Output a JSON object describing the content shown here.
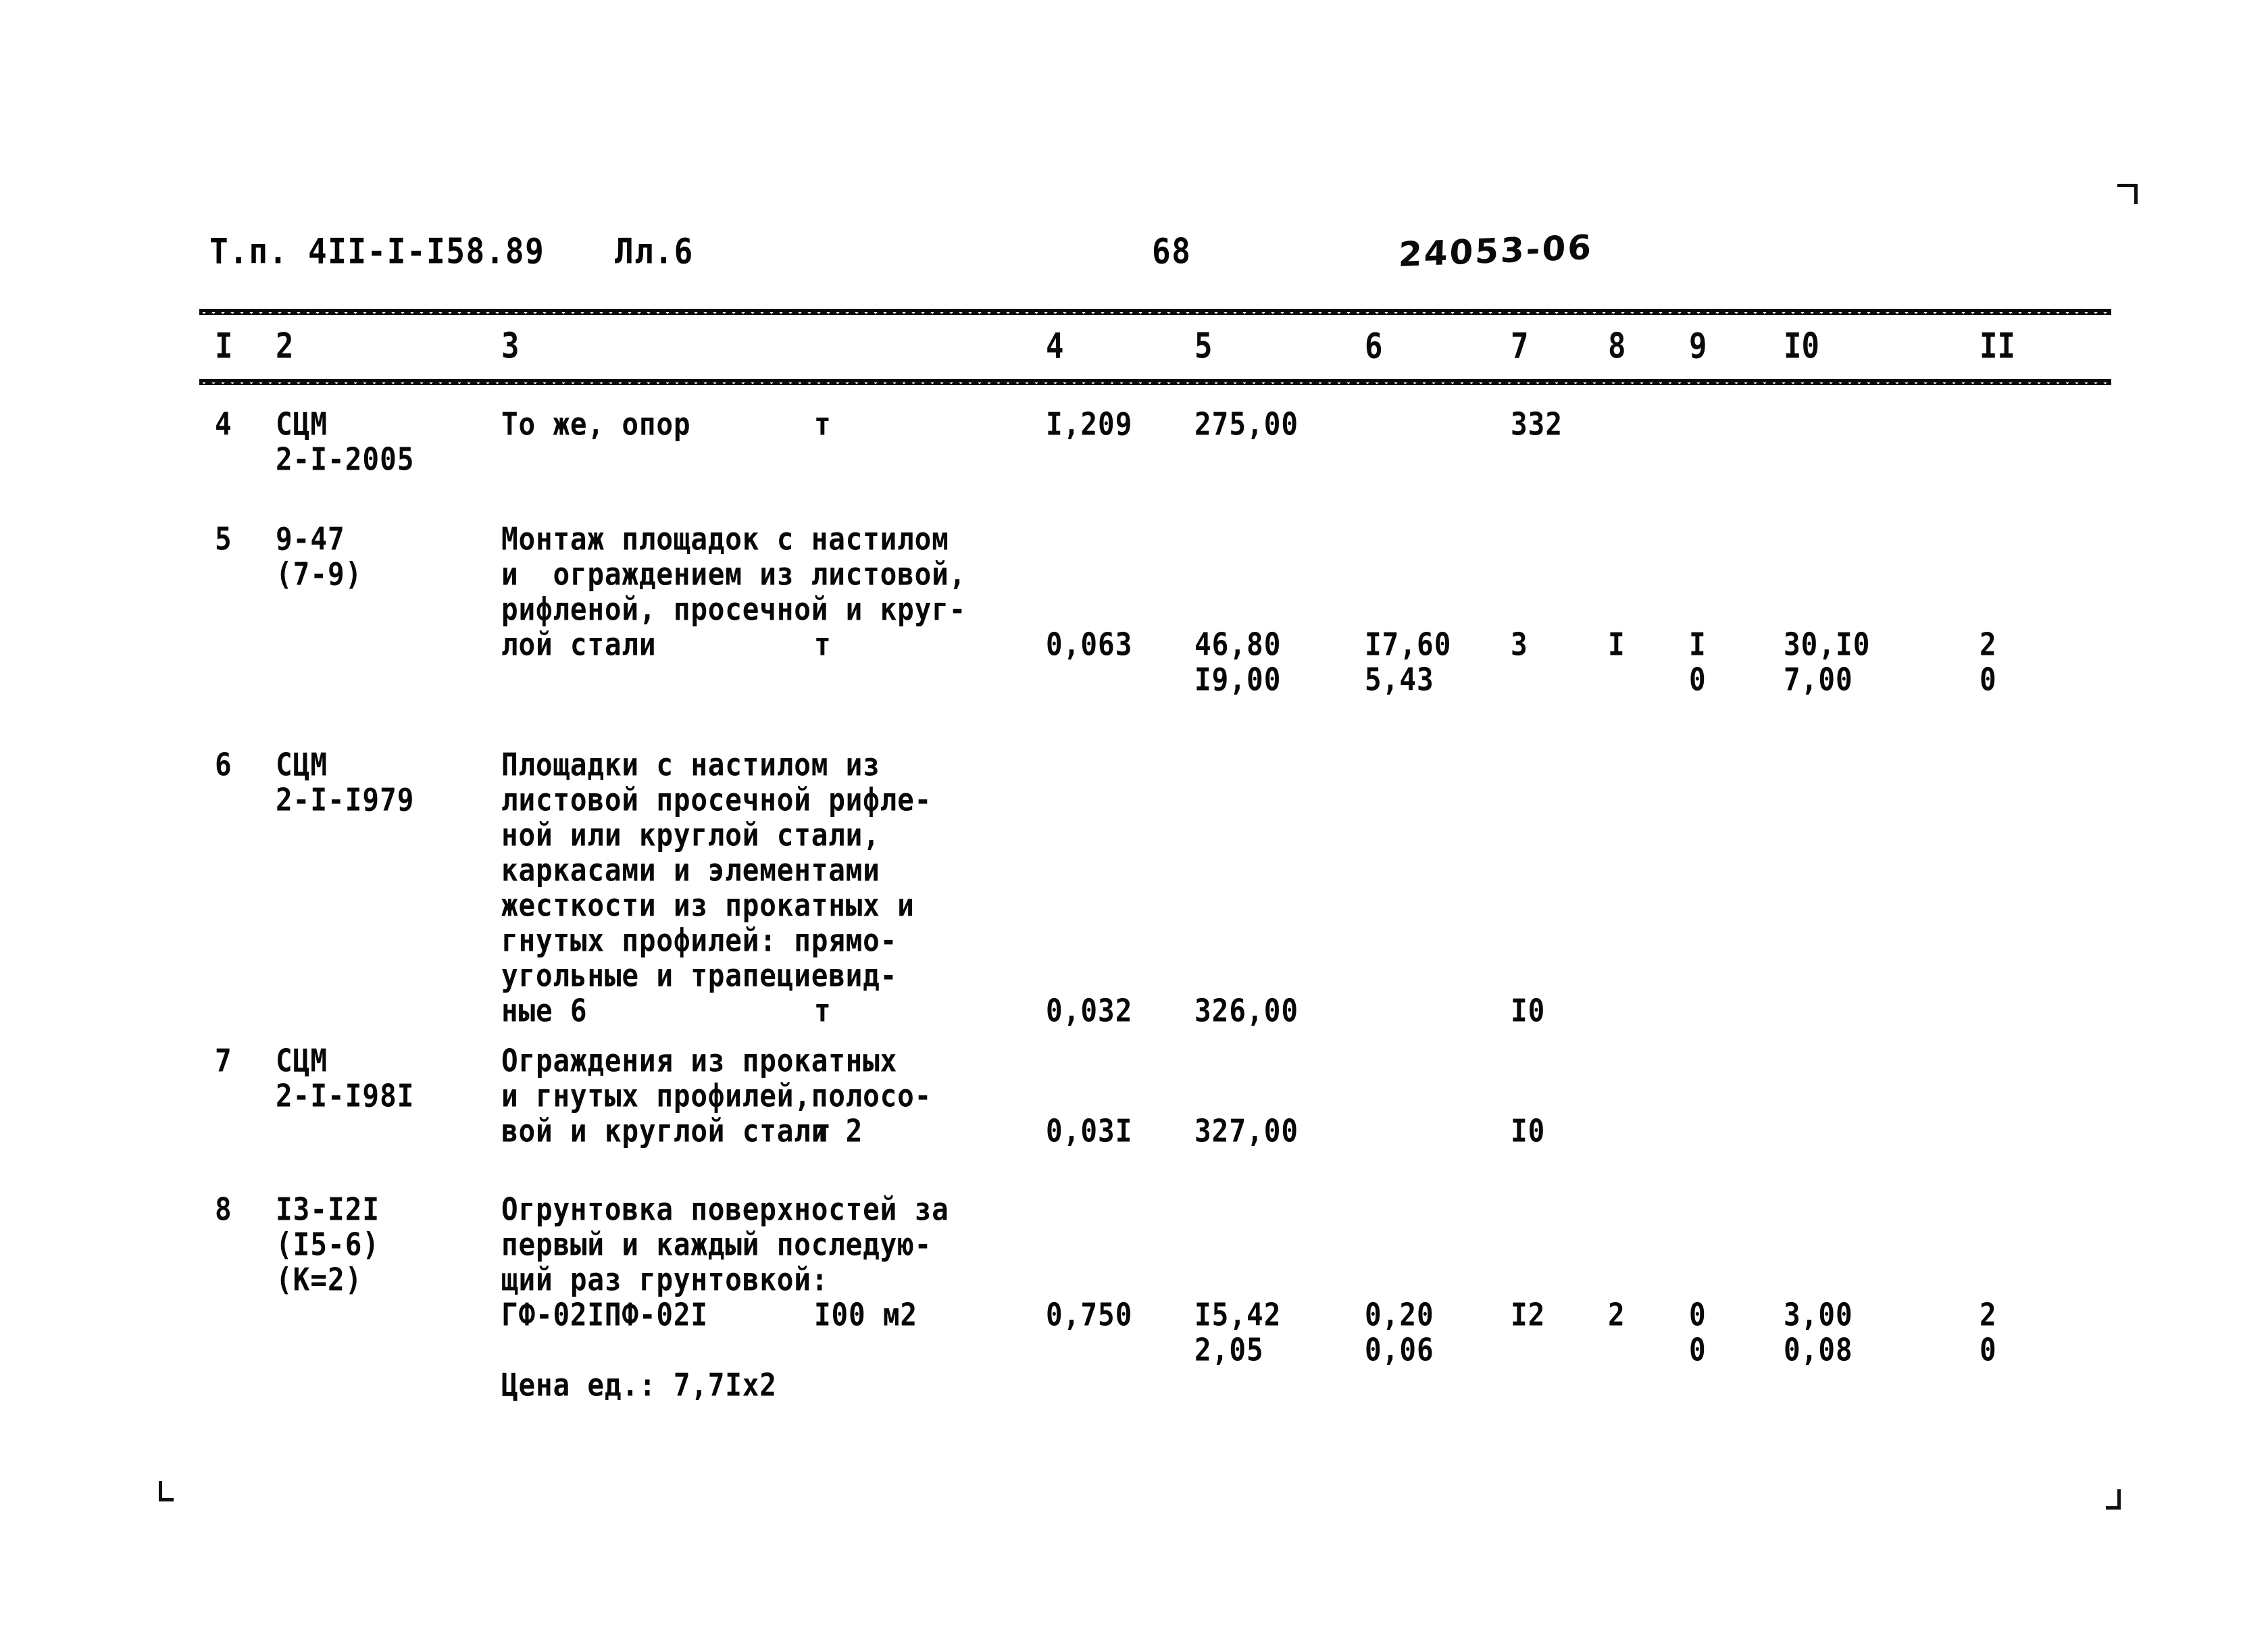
{
  "document": {
    "project_code": "Т.п. 4II-I-I58.89",
    "sheet_label": "Лл.6",
    "page_number": "68",
    "handwritten_code": "24053-06"
  },
  "table": {
    "column_headers": [
      "I",
      "2",
      "3",
      "4",
      "5",
      "6",
      "7",
      "8",
      "9",
      "I0",
      "II"
    ],
    "rows": [
      {
        "no": "4",
        "code_lines": [
          "СЦМ",
          "2-I-2005"
        ],
        "description_lines": [
          "То же, опор"
        ],
        "unit": "т",
        "c4": "I,209",
        "c5_top": "275,00",
        "c5_bot": "",
        "c6_top": "",
        "c6_bot": "",
        "c7": "332",
        "c8": "",
        "c9_top": "",
        "c9_bot": "",
        "c10_top": "",
        "c10_bot": "",
        "c11_top": "",
        "c11_bot": ""
      },
      {
        "no": "5",
        "code_lines": [
          "9-47",
          "(7-9)"
        ],
        "description_lines": [
          "Монтаж площадок с настилом",
          "и  ограждением из листовой,",
          "рифленой, просечной и круг-",
          "лой стали"
        ],
        "unit": "т",
        "c4": "0,063",
        "c5_top": "46,80",
        "c5_bot": "I9,00",
        "c6_top": "I7,60",
        "c6_bot": "5,43",
        "c7": "3",
        "c8": "I",
        "c9_top": "I",
        "c9_bot": "0",
        "c10_top": "30,I0",
        "c10_bot": "7,00",
        "c11_top": "2",
        "c11_bot": "0"
      },
      {
        "no": "6",
        "code_lines": [
          "СЦМ",
          "2-I-I979"
        ],
        "description_lines": [
          "Площадки с настилом из",
          "листовой просечной рифле-",
          "ной или круглой стали,",
          "каркасами и элементами",
          "жесткости из прокатных и",
          "гнутых профилей: прямо-",
          "угольные и трапециевид-",
          "ные 6"
        ],
        "unit": "т",
        "c4": "0,032",
        "c5_top": "326,00",
        "c5_bot": "",
        "c6_top": "",
        "c6_bot": "",
        "c7": "I0",
        "c8": "",
        "c9_top": "",
        "c9_bot": "",
        "c10_top": "",
        "c10_bot": "",
        "c11_top": "",
        "c11_bot": ""
      },
      {
        "no": "7",
        "code_lines": [
          "СЦМ",
          "2-I-I98I"
        ],
        "description_lines": [
          "Ограждения из прокатных",
          "и гнутых профилей,полосо-",
          "вой и круглой стали 2"
        ],
        "unit": "т",
        "c4": "0,03I",
        "c5_top": "327,00",
        "c5_bot": "",
        "c6_top": "",
        "c6_bot": "",
        "c7": "I0",
        "c8": "",
        "c9_top": "",
        "c9_bot": "",
        "c10_top": "",
        "c10_bot": "",
        "c11_top": "",
        "c11_bot": ""
      },
      {
        "no": "8",
        "code_lines": [
          "I3-I2I",
          "(I5-6)",
          "(К=2)"
        ],
        "description_lines": [
          "Огрунтовка поверхностей за",
          "первый и каждый последую-",
          "щий раз грунтовкой:",
          "ГФ-02IПФ-02I"
        ],
        "unit": "I00 м2",
        "c4": "0,750",
        "c5_top": "I5,42",
        "c5_bot": "2,05",
        "c6_top": "0,20",
        "c6_bot": "0,06",
        "c7": "I2",
        "c8": "2",
        "c9_top": "0",
        "c9_bot": "0",
        "c10_top": "3,00",
        "c10_bot": "0,08",
        "c11_top": "2",
        "c11_bot": "0",
        "note": "Цена ед.: 7,7Iх2"
      }
    ]
  }
}
